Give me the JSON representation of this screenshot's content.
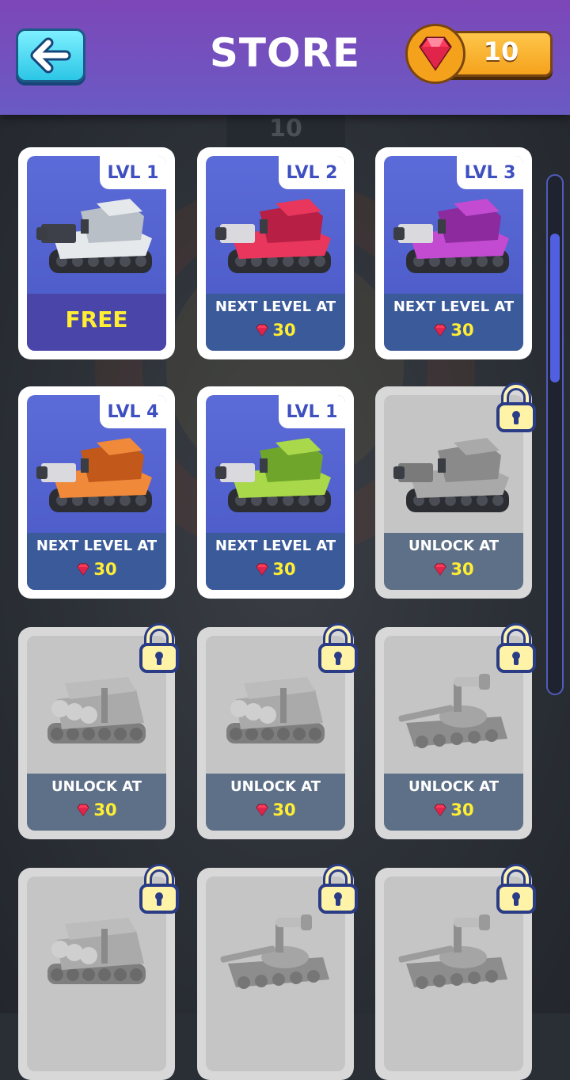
{
  "header": {
    "title": "STORE",
    "gems": "10",
    "back_icon": "arrow-left-icon",
    "gem_icon": "ruby-gem-icon"
  },
  "background_counter": "10",
  "colors": {
    "header_top": "#7d47b8",
    "header_bottom": "#6a5ac4",
    "accent_cyan": "#2bc6e6",
    "gem_pill": "#f4a21c",
    "price_yellow": "#ffee33"
  },
  "cards": [
    {
      "tank": "gray-camo",
      "level": "LVL 1",
      "footer": "FREE",
      "price": "",
      "locked": false,
      "free": true
    },
    {
      "tank": "red",
      "level": "LVL 2",
      "footer": "NEXT LEVEL AT",
      "price": "30",
      "locked": false
    },
    {
      "tank": "purple",
      "level": "LVL 3",
      "footer": "NEXT LEVEL AT",
      "price": "30",
      "locked": false
    },
    {
      "tank": "orange",
      "level": "LVL 4",
      "footer": "NEXT LEVEL AT",
      "price": "30",
      "locked": false
    },
    {
      "tank": "green",
      "level": "LVL 1",
      "footer": "NEXT LEVEL AT",
      "price": "30",
      "locked": false
    },
    {
      "tank": "gray-heavy",
      "level": "",
      "footer": "UNLOCK AT",
      "price": "30",
      "locked": true
    },
    {
      "tank": "rocket",
      "level": "",
      "footer": "UNLOCK AT",
      "price": "30",
      "locked": true
    },
    {
      "tank": "rocket",
      "level": "",
      "footer": "UNLOCK AT",
      "price": "30",
      "locked": true
    },
    {
      "tank": "scope",
      "level": "",
      "footer": "UNLOCK AT",
      "price": "30",
      "locked": true
    },
    {
      "tank": "rocket",
      "level": "",
      "footer": "",
      "price": "",
      "locked": true
    },
    {
      "tank": "scope",
      "level": "",
      "footer": "",
      "price": "",
      "locked": true
    },
    {
      "tank": "scope",
      "level": "",
      "footer": "",
      "price": "",
      "locked": true
    }
  ]
}
